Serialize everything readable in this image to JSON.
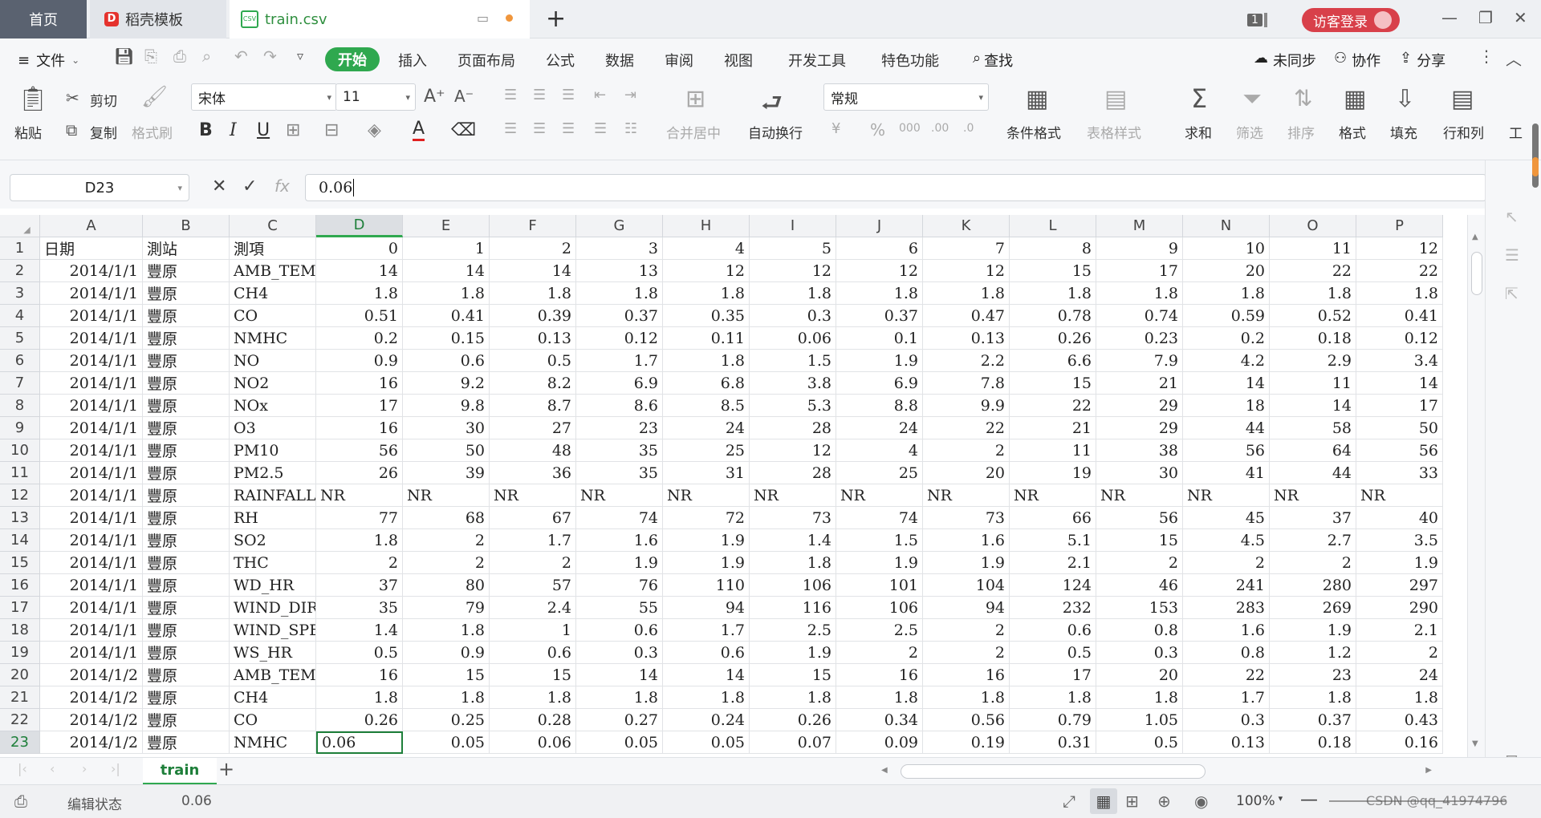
{
  "titlebar": {
    "home_tab": "首页",
    "template_tab": "稻壳模板",
    "file_tab": "train.csv",
    "badge": "1",
    "login": "访客登录"
  },
  "menu": {
    "file": "文件",
    "items": [
      "开始",
      "插入",
      "页面布局",
      "公式",
      "数据",
      "审阅",
      "视图",
      "开发工具",
      "特色功能",
      "查找"
    ],
    "sync": "未同步",
    "collab": "协作",
    "share": "分享"
  },
  "ribbon": {
    "paste": "粘贴",
    "cut": "剪切",
    "copy": "复制",
    "format_painter": "格式刷",
    "font_name": "宋体",
    "font_size": "11",
    "merge": "合并居中",
    "wrap": "自动换行",
    "number_format": "常规",
    "cond_format": "条件格式",
    "table_style": "表格样式",
    "sum": "求和",
    "filter": "筛选",
    "sort": "排序",
    "format": "格式",
    "fill": "填充",
    "rowcol": "行和列",
    "tools": "工"
  },
  "formula": {
    "cell_ref": "D23",
    "value": "0.06"
  },
  "grid": {
    "columns": [
      "A",
      "B",
      "C",
      "D",
      "E",
      "F",
      "G",
      "H",
      "I",
      "J",
      "K",
      "L",
      "M",
      "N",
      "O",
      "P"
    ],
    "rows": [
      [
        "日期",
        "測站",
        "測項",
        "0",
        "1",
        "2",
        "3",
        "4",
        "5",
        "6",
        "7",
        "8",
        "9",
        "10",
        "11",
        "12"
      ],
      [
        "2014/1/1",
        "豐原",
        "AMB_TEMP",
        "14",
        "14",
        "14",
        "13",
        "12",
        "12",
        "12",
        "12",
        "15",
        "17",
        "20",
        "22",
        "22"
      ],
      [
        "2014/1/1",
        "豐原",
        "CH4",
        "1.8",
        "1.8",
        "1.8",
        "1.8",
        "1.8",
        "1.8",
        "1.8",
        "1.8",
        "1.8",
        "1.8",
        "1.8",
        "1.8",
        "1.8"
      ],
      [
        "2014/1/1",
        "豐原",
        "CO",
        "0.51",
        "0.41",
        "0.39",
        "0.37",
        "0.35",
        "0.3",
        "0.37",
        "0.47",
        "0.78",
        "0.74",
        "0.59",
        "0.52",
        "0.41"
      ],
      [
        "2014/1/1",
        "豐原",
        "NMHC",
        "0.2",
        "0.15",
        "0.13",
        "0.12",
        "0.11",
        "0.06",
        "0.1",
        "0.13",
        "0.26",
        "0.23",
        "0.2",
        "0.18",
        "0.12"
      ],
      [
        "2014/1/1",
        "豐原",
        "NO",
        "0.9",
        "0.6",
        "0.5",
        "1.7",
        "1.8",
        "1.5",
        "1.9",
        "2.2",
        "6.6",
        "7.9",
        "4.2",
        "2.9",
        "3.4"
      ],
      [
        "2014/1/1",
        "豐原",
        "NO2",
        "16",
        "9.2",
        "8.2",
        "6.9",
        "6.8",
        "3.8",
        "6.9",
        "7.8",
        "15",
        "21",
        "14",
        "11",
        "14"
      ],
      [
        "2014/1/1",
        "豐原",
        "NOx",
        "17",
        "9.8",
        "8.7",
        "8.6",
        "8.5",
        "5.3",
        "8.8",
        "9.9",
        "22",
        "29",
        "18",
        "14",
        "17"
      ],
      [
        "2014/1/1",
        "豐原",
        "O3",
        "16",
        "30",
        "27",
        "23",
        "24",
        "28",
        "24",
        "22",
        "21",
        "29",
        "44",
        "58",
        "50"
      ],
      [
        "2014/1/1",
        "豐原",
        "PM10",
        "56",
        "50",
        "48",
        "35",
        "25",
        "12",
        "4",
        "2",
        "11",
        "38",
        "56",
        "64",
        "56"
      ],
      [
        "2014/1/1",
        "豐原",
        "PM2.5",
        "26",
        "39",
        "36",
        "35",
        "31",
        "28",
        "25",
        "20",
        "19",
        "30",
        "41",
        "44",
        "33"
      ],
      [
        "2014/1/1",
        "豐原",
        "RAINFALL",
        "NR",
        "NR",
        "NR",
        "NR",
        "NR",
        "NR",
        "NR",
        "NR",
        "NR",
        "NR",
        "NR",
        "NR",
        "NR"
      ],
      [
        "2014/1/1",
        "豐原",
        "RH",
        "77",
        "68",
        "67",
        "74",
        "72",
        "73",
        "74",
        "73",
        "66",
        "56",
        "45",
        "37",
        "40"
      ],
      [
        "2014/1/1",
        "豐原",
        "SO2",
        "1.8",
        "2",
        "1.7",
        "1.6",
        "1.9",
        "1.4",
        "1.5",
        "1.6",
        "5.1",
        "15",
        "4.5",
        "2.7",
        "3.5"
      ],
      [
        "2014/1/1",
        "豐原",
        "THC",
        "2",
        "2",
        "2",
        "1.9",
        "1.9",
        "1.8",
        "1.9",
        "1.9",
        "2.1",
        "2",
        "2",
        "2",
        "1.9"
      ],
      [
        "2014/1/1",
        "豐原",
        "WD_HR",
        "37",
        "80",
        "57",
        "76",
        "110",
        "106",
        "101",
        "104",
        "124",
        "46",
        "241",
        "280",
        "297"
      ],
      [
        "2014/1/1",
        "豐原",
        "WIND_DIREC",
        "35",
        "79",
        "2.4",
        "55",
        "94",
        "116",
        "106",
        "94",
        "232",
        "153",
        "283",
        "269",
        "290"
      ],
      [
        "2014/1/1",
        "豐原",
        "WIND_SPEED",
        "1.4",
        "1.8",
        "1",
        "0.6",
        "1.7",
        "2.5",
        "2.5",
        "2",
        "0.6",
        "0.8",
        "1.6",
        "1.9",
        "2.1"
      ],
      [
        "2014/1/1",
        "豐原",
        "WS_HR",
        "0.5",
        "0.9",
        "0.6",
        "0.3",
        "0.6",
        "1.9",
        "2",
        "2",
        "0.5",
        "0.3",
        "0.8",
        "1.2",
        "2"
      ],
      [
        "2014/1/2",
        "豐原",
        "AMB_TEMP",
        "16",
        "15",
        "15",
        "14",
        "14",
        "15",
        "16",
        "16",
        "17",
        "20",
        "22",
        "23",
        "24"
      ],
      [
        "2014/1/2",
        "豐原",
        "CH4",
        "1.8",
        "1.8",
        "1.8",
        "1.8",
        "1.8",
        "1.8",
        "1.8",
        "1.8",
        "1.8",
        "1.8",
        "1.7",
        "1.8",
        "1.8"
      ],
      [
        "2014/1/2",
        "豐原",
        "CO",
        "0.26",
        "0.25",
        "0.28",
        "0.27",
        "0.24",
        "0.26",
        "0.34",
        "0.56",
        "0.79",
        "1.05",
        "0.3",
        "0.37",
        "0.43"
      ],
      [
        "2014/1/2",
        "豐原",
        "NMHC",
        "0.06",
        "0.05",
        "0.06",
        "0.05",
        "0.05",
        "0.07",
        "0.09",
        "0.19",
        "0.31",
        "0.5",
        "0.13",
        "0.18",
        "0.16"
      ]
    ]
  },
  "sheet": {
    "name": "train"
  },
  "status": {
    "mode": "编辑状态",
    "value": "0.06",
    "zoom": "100%",
    "watermark": "CSDN @qq_41974796"
  }
}
